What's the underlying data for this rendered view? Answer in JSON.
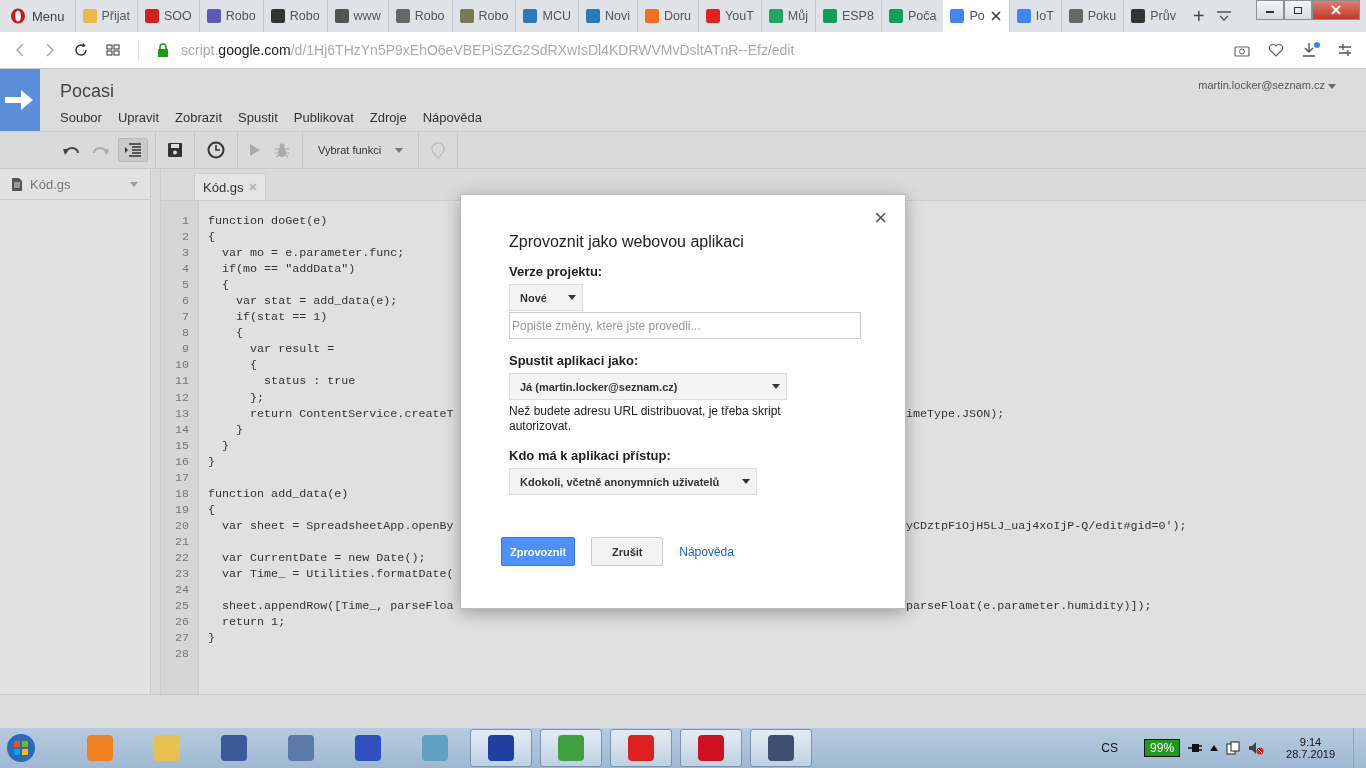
{
  "browser": {
    "menu_label": "Menu",
    "tabs": [
      {
        "label": "Přijat",
        "color": "#e8b84a",
        "selected": false
      },
      {
        "label": "SOO",
        "color": "#d6201f",
        "selected": false
      },
      {
        "label": "Robo",
        "color": "#5a5ab8",
        "selected": false
      },
      {
        "label": "Robo",
        "color": "#333333",
        "selected": false
      },
      {
        "label": "www",
        "color": "#555555",
        "selected": false
      },
      {
        "label": "Robo",
        "color": "#666666",
        "selected": false
      },
      {
        "label": "Robo",
        "color": "#7a7a5a",
        "selected": false
      },
      {
        "label": "MCU",
        "color": "#2a7ab8",
        "selected": false
      },
      {
        "label": "Novi",
        "color": "#2a7ab8",
        "selected": false
      },
      {
        "label": "Doru",
        "color": "#f07020",
        "selected": false
      },
      {
        "label": "YouT",
        "color": "#e62117",
        "selected": false
      },
      {
        "label": "Můj",
        "color": "#1fa463",
        "selected": false
      },
      {
        "label": "ESP8",
        "color": "#0f9d58",
        "selected": false
      },
      {
        "label": "Poča",
        "color": "#0f9d58",
        "selected": false
      },
      {
        "label": "Po",
        "color": "#4285f4",
        "selected": true
      },
      {
        "label": "IoT",
        "color": "#4285f4",
        "selected": false
      },
      {
        "label": "Poku",
        "color": "#666666",
        "selected": false
      },
      {
        "label": "Prův",
        "color": "#333333",
        "selected": false
      }
    ],
    "new_tab": "+",
    "url_scheme": "script.",
    "url_host": "google.com",
    "url_path": "/d/1Hj6THzYn5P9xEhO6eVBEPiSZG2SdRXwIsDl4KDRWVMvDsltATnR--Efz/edit"
  },
  "app": {
    "title": "Pocasi",
    "account": "martin.locker@seznam.cz",
    "menu": [
      "Soubor",
      "Upravit",
      "Zobrazit",
      "Spustit",
      "Publikovat",
      "Zdroje",
      "Nápověda"
    ],
    "function_select": "Vybrat funkci",
    "sidebar_file": "Kód.gs",
    "editor_tab": "Kód.gs"
  },
  "code_lines": [
    {
      "number": "1",
      "text": "function doGet(e)"
    },
    {
      "number": "2",
      "text": "{"
    },
    {
      "number": "3",
      "text": "  var mo = e.parameter.func;"
    },
    {
      "number": "4",
      "text": "  if(mo == \"addData\")"
    },
    {
      "number": "5",
      "text": "  {"
    },
    {
      "number": "6",
      "text": "    var stat = add_data(e);"
    },
    {
      "number": "7",
      "text": "    if(stat == 1)"
    },
    {
      "number": "8",
      "text": "    {"
    },
    {
      "number": "9",
      "text": "      var result ="
    },
    {
      "number": "10",
      "text": "      {"
    },
    {
      "number": "11",
      "text": "        status : true"
    },
    {
      "number": "12",
      "text": "      };"
    },
    {
      "number": "13",
      "text": "      return ContentService.createT",
      "tail": "imeType.JSON);"
    },
    {
      "number": "14",
      "text": "    }"
    },
    {
      "number": "15",
      "text": "  }"
    },
    {
      "number": "16",
      "text": "}"
    },
    {
      "number": "17"
    },
    {
      "number": "18",
      "text": "function add_data(e)"
    },
    {
      "number": "19",
      "text": "{"
    },
    {
      "number": "20",
      "text": "  var sheet = SpreadsheetApp.openBy",
      "tail": "yCDztpF1OjH5LJ_uaj4xoIjP-Q/edit#gid=0');"
    },
    {
      "number": "21"
    },
    {
      "number": "22",
      "text": "  var CurrentDate = new Date();"
    },
    {
      "number": "23",
      "text": "  var Time_ = Utilities.formatDate("
    },
    {
      "number": "24"
    },
    {
      "number": "25",
      "text": "  sheet.appendRow([Time_, parseFloa",
      "tail": "parseFloat(e.parameter.humidity)]);"
    },
    {
      "number": "26",
      "text": "  return 1;"
    },
    {
      "number": "27",
      "text": "}"
    },
    {
      "number": "28"
    }
  ],
  "dialog": {
    "close": "×",
    "title": "Zprovoznit jako webovou aplikaci",
    "version_label": "Verze projektu:",
    "version_value": "Nové",
    "changes_placeholder": "Popište změny, které jste provedli...",
    "run_as_label": "Spustit aplikaci jako:",
    "run_as_value": "Já (martin.locker@seznam.cz)",
    "note": "Než budete adresu URL distribuovat, je třeba skript autorizovat.",
    "access_label": "Kdo má k aplikaci přístup:",
    "access_value": "Kdokoli, včetně anonymních uživatelů",
    "buttons": [
      {
        "label": "Zprovoznit",
        "kind": "primary"
      },
      {
        "label": "Zrušit",
        "kind": "secondary"
      },
      {
        "label": "Nápověda",
        "kind": "link"
      }
    ]
  },
  "taskbar": {
    "apps": [
      {
        "color": "#f08020",
        "running": false
      },
      {
        "color": "#e8c050",
        "running": false
      },
      {
        "color": "#3a5a9a",
        "running": false
      },
      {
        "color": "#5a7aa8",
        "running": false
      },
      {
        "color": "#3050c0",
        "running": false
      },
      {
        "color": "#60a0c0",
        "running": false
      },
      {
        "color": "#2040a0",
        "running": true
      },
      {
        "color": "#40a040",
        "running": true
      },
      {
        "color": "#e02020",
        "running": true
      },
      {
        "color": "#d01020",
        "running": true
      },
      {
        "color": "#405070",
        "running": true
      }
    ],
    "language": "CS",
    "battery": "99%",
    "time": "9:14",
    "date": "28.7.2019"
  }
}
